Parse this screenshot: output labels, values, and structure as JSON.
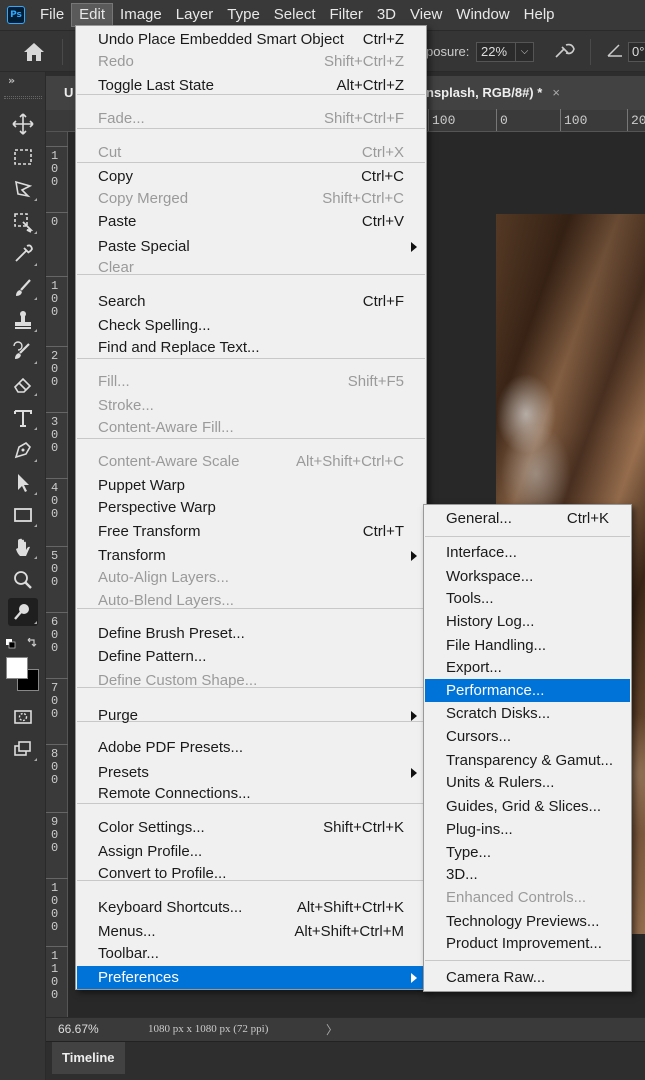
{
  "app": {
    "logo": "Ps"
  },
  "menubar": {
    "items": [
      {
        "label": "File"
      },
      {
        "label": "Edit"
      },
      {
        "label": "Image"
      },
      {
        "label": "Layer"
      },
      {
        "label": "Type"
      },
      {
        "label": "Select"
      },
      {
        "label": "Filter"
      },
      {
        "label": "3D"
      },
      {
        "label": "View"
      },
      {
        "label": "Window"
      },
      {
        "label": "Help"
      }
    ],
    "active": "Edit"
  },
  "options_bar": {
    "exposure_label": "posure:",
    "exposure_value": "22%",
    "dropdown_glyph": "⌵",
    "angle_value": "0°"
  },
  "document": {
    "left_tab_label": "U",
    "tab_title": "nsplash, RGB/8#) *",
    "tab_close": "×",
    "hruler_labels": [
      "100",
      "0",
      "100",
      "20"
    ],
    "vruler_labels": [
      "1\n0\n0",
      "0",
      "1\n0\n0",
      "2\n0\n0",
      "3\n0\n0",
      "4\n0\n0",
      "5\n0\n0",
      "6\n0\n0",
      "7\n0\n0",
      "8\n0\n0",
      "9\n0\n0",
      "1\n0\n0\n0",
      "1\n1\n0\n0"
    ]
  },
  "status": {
    "zoom": "66.67%",
    "doc_info": "1080 px x 1080 px (72 ppi)",
    "chevron": "〉"
  },
  "timeline": {
    "label": "Timeline"
  },
  "toolbar": {
    "collapse": "»"
  },
  "edit_menu": {
    "items": [
      {
        "label": "Undo Place Embedded Smart Object",
        "shortcut": "Ctrl+Z"
      },
      {
        "label": "Redo",
        "shortcut": "Shift+Ctrl+Z",
        "disabled": true
      },
      {
        "label": "Toggle Last State",
        "shortcut": "Alt+Ctrl+Z"
      },
      {
        "label": "Fade...",
        "shortcut": "Shift+Ctrl+F",
        "disabled": true
      },
      {
        "label": "Cut",
        "shortcut": "Ctrl+X",
        "disabled": true
      },
      {
        "label": "Copy",
        "shortcut": "Ctrl+C"
      },
      {
        "label": "Copy Merged",
        "shortcut": "Shift+Ctrl+C",
        "disabled": true
      },
      {
        "label": "Paste",
        "shortcut": "Ctrl+V"
      },
      {
        "label": "Paste Special",
        "shortcut": ""
      },
      {
        "label": "Clear",
        "shortcut": "",
        "disabled": true
      },
      {
        "label": "Search",
        "shortcut": "Ctrl+F"
      },
      {
        "label": "Check Spelling...",
        "shortcut": ""
      },
      {
        "label": "Find and Replace Text...",
        "shortcut": ""
      },
      {
        "label": "Fill...",
        "shortcut": "Shift+F5",
        "disabled": true
      },
      {
        "label": "Stroke...",
        "shortcut": "",
        "disabled": true
      },
      {
        "label": "Content-Aware Fill...",
        "shortcut": "",
        "disabled": true
      },
      {
        "label": "Content-Aware Scale",
        "shortcut": "Alt+Shift+Ctrl+C",
        "disabled": true
      },
      {
        "label": "Puppet Warp",
        "shortcut": ""
      },
      {
        "label": "Perspective Warp",
        "shortcut": ""
      },
      {
        "label": "Free Transform",
        "shortcut": "Ctrl+T"
      },
      {
        "label": "Transform",
        "shortcut": ""
      },
      {
        "label": "Auto-Align Layers...",
        "shortcut": "",
        "disabled": true
      },
      {
        "label": "Auto-Blend Layers...",
        "shortcut": "",
        "disabled": true
      },
      {
        "label": "Define Brush Preset...",
        "shortcut": ""
      },
      {
        "label": "Define Pattern...",
        "shortcut": ""
      },
      {
        "label": "Define Custom Shape...",
        "shortcut": "",
        "disabled": true
      },
      {
        "label": "Purge",
        "shortcut": ""
      },
      {
        "label": "Adobe PDF Presets...",
        "shortcut": ""
      },
      {
        "label": "Presets",
        "shortcut": ""
      },
      {
        "label": "Remote Connections...",
        "shortcut": ""
      },
      {
        "label": "Color Settings...",
        "shortcut": "Shift+Ctrl+K"
      },
      {
        "label": "Assign Profile...",
        "shortcut": ""
      },
      {
        "label": "Convert to Profile...",
        "shortcut": ""
      },
      {
        "label": "Keyboard Shortcuts...",
        "shortcut": "Alt+Shift+Ctrl+K"
      },
      {
        "label": "Menus...",
        "shortcut": "Alt+Shift+Ctrl+M"
      },
      {
        "label": "Toolbar...",
        "shortcut": ""
      },
      {
        "label": "Preferences",
        "shortcut": "",
        "highlighted": true
      }
    ]
  },
  "preferences_menu": {
    "items": [
      {
        "label": "General...",
        "shortcut": "Ctrl+K"
      },
      {
        "label": "Interface..."
      },
      {
        "label": "Workspace..."
      },
      {
        "label": "Tools..."
      },
      {
        "label": "History Log..."
      },
      {
        "label": "File Handling..."
      },
      {
        "label": "Export..."
      },
      {
        "label": "Performance...",
        "highlighted": true
      },
      {
        "label": "Scratch Disks..."
      },
      {
        "label": "Cursors..."
      },
      {
        "label": "Transparency & Gamut..."
      },
      {
        "label": "Units & Rulers..."
      },
      {
        "label": "Guides, Grid & Slices..."
      },
      {
        "label": "Plug-ins..."
      },
      {
        "label": "Type..."
      },
      {
        "label": "3D..."
      },
      {
        "label": "Enhanced Controls...",
        "disabled": true
      },
      {
        "label": "Technology Previews..."
      },
      {
        "label": "Product Improvement..."
      },
      {
        "label": "Camera Raw..."
      }
    ]
  },
  "colors": {
    "highlight": "#0073d9",
    "menu_bg": "#f0f0f0",
    "disabled_text": "#9a9a9a",
    "chrome": "#353535"
  }
}
